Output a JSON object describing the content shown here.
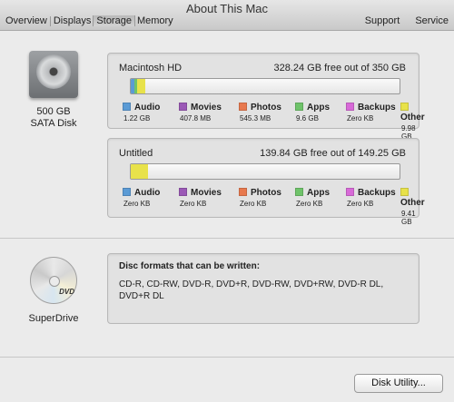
{
  "window": {
    "title": "About This Mac"
  },
  "tabs": [
    {
      "label": "Overview"
    },
    {
      "label": "Displays"
    },
    {
      "label": "Storage"
    },
    {
      "label": "Memory"
    }
  ],
  "toolbar": {
    "support": "Support",
    "service": "Service"
  },
  "hard_disk": {
    "size": "500 GB",
    "type": "SATA Disk"
  },
  "volumes": [
    {
      "name": "Macintosh HD",
      "free": "328.24 GB free out of 350 GB",
      "categories": [
        {
          "name": "Audio",
          "size": "1.22 GB",
          "color": "#5b9bd5"
        },
        {
          "name": "Movies",
          "size": "407.8 MB",
          "color": "#9b59b6"
        },
        {
          "name": "Photos",
          "size": "545.3 MB",
          "color": "#e8794e"
        },
        {
          "name": "Apps",
          "size": "9.6 GB",
          "color": "#6fc36a"
        },
        {
          "name": "Backups",
          "size": "Zero KB",
          "color": "#d86ad8"
        },
        {
          "name": "Other",
          "size": "9.98 GB",
          "color": "#e8e24a"
        }
      ]
    },
    {
      "name": "Untitled",
      "free": "139.84 GB free out of 149.25 GB",
      "categories": [
        {
          "name": "Audio",
          "size": "Zero KB",
          "color": "#5b9bd5"
        },
        {
          "name": "Movies",
          "size": "Zero KB",
          "color": "#9b59b6"
        },
        {
          "name": "Photos",
          "size": "Zero KB",
          "color": "#e8794e"
        },
        {
          "name": "Apps",
          "size": "Zero KB",
          "color": "#6fc36a"
        },
        {
          "name": "Backups",
          "size": "Zero KB",
          "color": "#d86ad8"
        },
        {
          "name": "Other",
          "size": "9.41 GB",
          "color": "#e8e24a"
        }
      ]
    }
  ],
  "superdrive": {
    "label": "SuperDrive",
    "logo": "DVD",
    "disc_title": "Disc formats that can be written:",
    "formats": "CD-R, CD-RW, DVD-R, DVD+R, DVD-RW, DVD+RW, DVD-R DL, DVD+R DL"
  },
  "disk_utility_button": "Disk Utility..."
}
